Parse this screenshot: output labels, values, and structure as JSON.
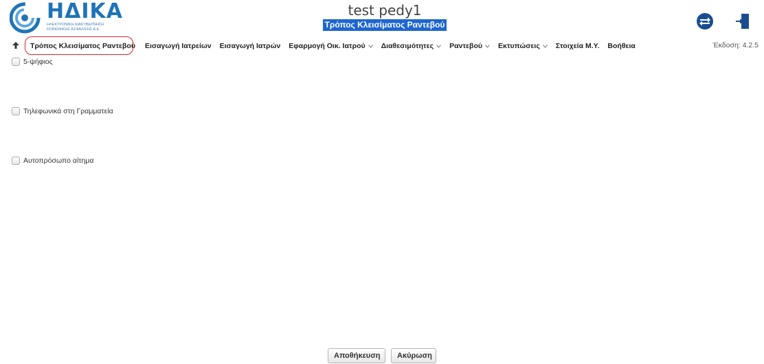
{
  "header": {
    "logo_text": "ΗΔΙΚΑ",
    "logo_subtitle": "ΗΛΕΚΤΡΟΝΙΚΗ ΔΙΑΚΥΒΕΡΝΗΣΗ ΚΟΙΝΩΝΙΚΗΣ ΑΣΦΑΛΙΣΗΣ Α.Ε.",
    "app_title": "test pedy1",
    "page_subtitle": "Τρόπος Κλεισίματος Ραντεβού",
    "icons": [
      "swap-arrows-icon",
      "logout-door-icon"
    ]
  },
  "nav": {
    "items": [
      {
        "label": "Τρόπος Κλεισίματος Ραντεβού",
        "dropdown": false,
        "highlighted": true
      },
      {
        "label": "Εισαγωγή Ιατρείων",
        "dropdown": false
      },
      {
        "label": "Εισαγωγή Ιατρών",
        "dropdown": false
      },
      {
        "label": "Εφαρμογή Οικ. Ιατρού",
        "dropdown": true
      },
      {
        "label": "Διαθεσιμότητες",
        "dropdown": true
      },
      {
        "label": "Ραντεβού",
        "dropdown": true
      },
      {
        "label": "Εκτυπώσεις",
        "dropdown": true
      },
      {
        "label": "Στοιχεία Μ.Υ.",
        "dropdown": false
      },
      {
        "label": "Βοήθεια",
        "dropdown": false
      }
    ],
    "version": "Έκδοση: 4.2.5"
  },
  "options": [
    {
      "label": "5-ψήφιος",
      "checked": false
    },
    {
      "label": "Τηλεφωνικά στη Γραμματεία",
      "checked": false
    },
    {
      "label": "Αυτοπρόσωπο αίτημα",
      "checked": false
    }
  ],
  "footer": {
    "save_label": "Αποθήκευση",
    "cancel_label": "Ακύρωση"
  },
  "colors": {
    "brand_blue": "#1f74b8",
    "subtitle_bg": "#1e66d0",
    "highlight_red": "#d9262a"
  }
}
